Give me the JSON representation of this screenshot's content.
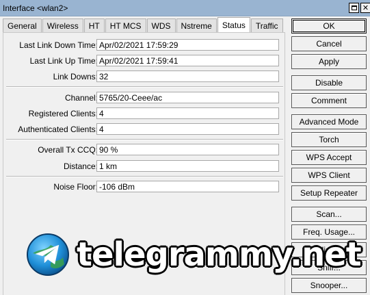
{
  "window": {
    "title": "Interface <wlan2>"
  },
  "tabs": [
    "General",
    "Wireless",
    "HT",
    "HT MCS",
    "WDS",
    "Nstreme",
    "Status",
    "Traffic"
  ],
  "active_tab": "Status",
  "fields": [
    {
      "label": "Last Link Down Time:",
      "value": "Apr/02/2021 17:59:29"
    },
    {
      "label": "Last Link Up Time:",
      "value": "Apr/02/2021 17:59:41"
    },
    {
      "label": "Link Downs:",
      "value": "32"
    },
    {
      "label": "Channel:",
      "value": "5765/20-Ceee/ac"
    },
    {
      "label": "Registered Clients:",
      "value": "4"
    },
    {
      "label": "Authenticated Clients:",
      "value": "4"
    },
    {
      "label": "Overall Tx CCQ:",
      "value": "90 %"
    },
    {
      "label": "Distance:",
      "value": "1 km"
    },
    {
      "label": "Noise Floor:",
      "value": "-106 dBm"
    }
  ],
  "buttons": [
    "OK",
    "Cancel",
    "Apply",
    "Disable",
    "Comment",
    "Advanced Mode",
    "Torch",
    "WPS Accept",
    "WPS Client",
    "Setup Repeater",
    "Scan...",
    "Freq. Usage...",
    "Align...",
    "Sniff...",
    "Snooper..."
  ],
  "watermark": {
    "text": "telegrammy.net",
    "icon": "telegram-logo-icon"
  }
}
